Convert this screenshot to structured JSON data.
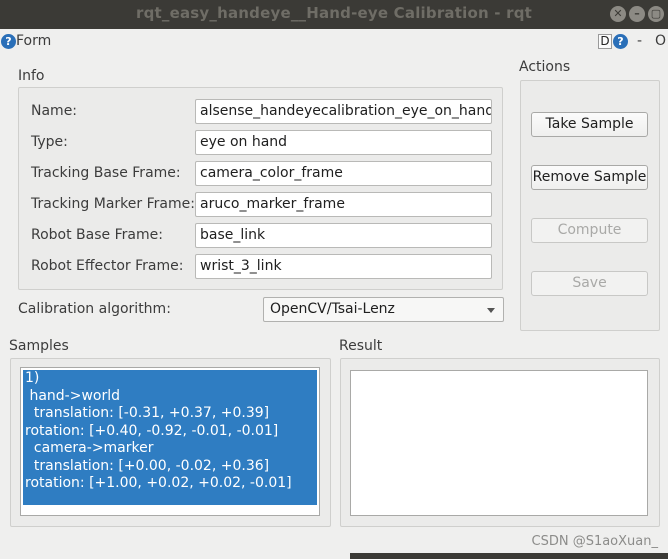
{
  "window": {
    "title": "rqt_easy_handeye__Hand-eye Calibration - rqt",
    "close_glyph": "✕",
    "minimize_glyph": "–",
    "maximize_glyph": "▢"
  },
  "plugin": {
    "title": "Form",
    "help_glyph": "?",
    "dock_glyph": "D",
    "close_glyph": "-",
    "options_glyph": "O"
  },
  "info": {
    "title": "Info",
    "rows": [
      {
        "label": "Name:",
        "value": "alsense_handeyecalibration_eye_on_hand/"
      },
      {
        "label": "Type:",
        "value": "eye on hand"
      },
      {
        "label": "Tracking Base Frame:",
        "value": "camera_color_frame"
      },
      {
        "label": "Tracking Marker Frame:",
        "value": "aruco_marker_frame"
      },
      {
        "label": "Robot Base Frame:",
        "value": "base_link"
      },
      {
        "label": "Robot Effector Frame:",
        "value": "wrist_3_link"
      }
    ]
  },
  "calibration": {
    "label": "Calibration algorithm:",
    "selected": "OpenCV/Tsai-Lenz"
  },
  "actions": {
    "title": "Actions",
    "take_sample": "Take Sample",
    "remove_sample": "Remove Sample",
    "compute": "Compute",
    "save": "Save"
  },
  "samples": {
    "title": "Samples",
    "items": [
      "1)\n hand->world\n  translation: [-0.31, +0.37, +0.39]\nrotation: [+0.40, -0.92, -0.01, -0.01]\n  camera->marker\n  translation: [+0.00, -0.02, +0.36]\nrotation: [+1.00, +0.02, +0.02, -0.01]"
    ]
  },
  "result": {
    "title": "Result",
    "text": ""
  },
  "watermark": "CSDN @S1aoXuan_"
}
